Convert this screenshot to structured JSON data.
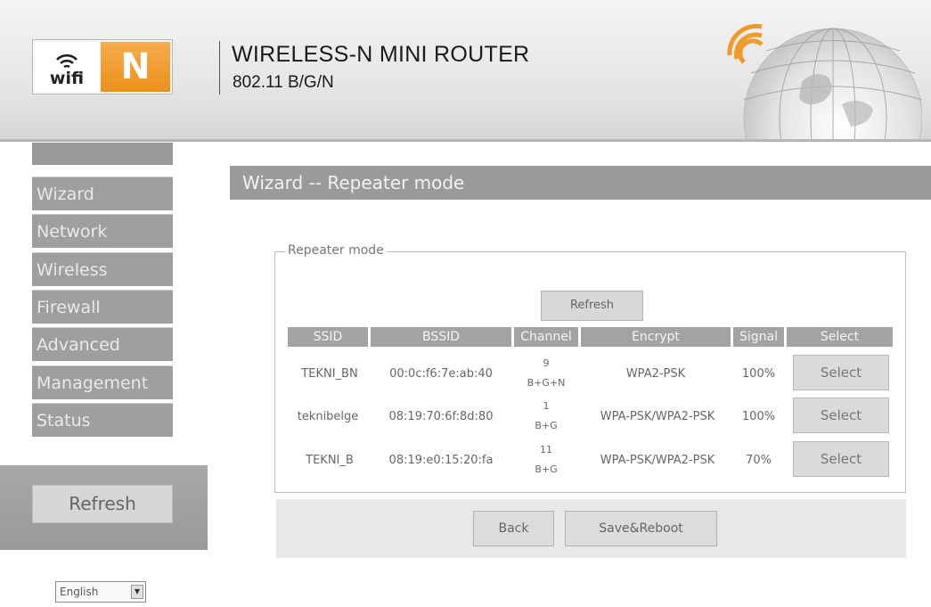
{
  "header": {
    "logo_wifi": "wifi",
    "logo_n": "N",
    "title": "WIRELESS-N MINI ROUTER",
    "subtitle": "802.11 B/G/N",
    "accent_color": "#ef9a2a"
  },
  "sidebar": {
    "items": [
      {
        "label": "Wizard",
        "icon": ""
      },
      {
        "label": "Network",
        "icon": ""
      },
      {
        "label": "Wireless",
        "icon": ""
      },
      {
        "label": "Firewall",
        "icon": ""
      },
      {
        "label": "Advanced",
        "icon": ""
      },
      {
        "label": "Management",
        "icon": ""
      },
      {
        "label": "Status",
        "icon": ""
      }
    ],
    "refresh_label": "Refresh",
    "language": "English"
  },
  "main": {
    "page_title": "Wizard -- Repeater mode",
    "legend": "Repeater mode",
    "refresh_label": "Refresh",
    "table": {
      "headers": [
        "SSID",
        "BSSID",
        "Channel",
        "Encrypt",
        "Signal",
        "Select"
      ],
      "rows": [
        {
          "ssid": "TEKNI_BN",
          "bssid": "00:0c:f6:7e:ab:40",
          "channel": "9",
          "mode": "B+G+N",
          "encrypt": "WPA2-PSK",
          "signal": "100%",
          "select": "Select"
        },
        {
          "ssid": "teknibelge",
          "bssid": "08:19:70:6f:8d:80",
          "channel": "1",
          "mode": "B+G",
          "encrypt": "WPA-PSK/WPA2-PSK",
          "signal": "100%",
          "select": "Select"
        },
        {
          "ssid": "TEKNI_B",
          "bssid": "08:19:e0:15:20:fa",
          "channel": "11",
          "mode": "B+G",
          "encrypt": "WPA-PSK/WPA2-PSK",
          "signal": "70%",
          "select": "Select"
        }
      ]
    },
    "back_label": "Back",
    "save_label": "Save&Reboot"
  }
}
